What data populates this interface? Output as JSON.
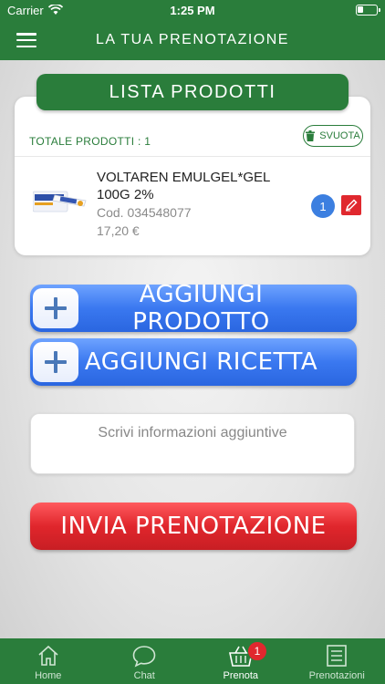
{
  "status_bar": {
    "carrier": "Carrier",
    "time": "1:25 PM"
  },
  "header": {
    "title": "LA TUA PRENOTAZIONE"
  },
  "product_list": {
    "title": "LISTA PRODOTTI",
    "total_label": "TOTALE PRODOTTI : 1",
    "clear_label": "SVUOTA",
    "items": [
      {
        "name": "VOLTAREN EMULGEL*GEL 100G 2%",
        "code": "Cod. 034548077",
        "price": "17,20 €",
        "quantity": "1"
      }
    ]
  },
  "actions": {
    "add_product": "AGGIUNGI PRODOTTO",
    "add_prescription": "AGGIUNGI RICETTA"
  },
  "notes": {
    "placeholder": "Scrivi informazioni aggiuntive"
  },
  "submit": {
    "label": "INVIA PRENOTAZIONE"
  },
  "tabs": [
    {
      "label": "Home",
      "icon": "home-icon"
    },
    {
      "label": "Chat",
      "icon": "chat-icon"
    },
    {
      "label": "Prenota",
      "icon": "basket-icon",
      "badge": "1",
      "active": true
    },
    {
      "label": "Prenotazioni",
      "icon": "list-icon"
    }
  ],
  "colors": {
    "primary_green": "#2a7d3b",
    "action_blue": "#3a78f0",
    "submit_red": "#e0282e"
  }
}
